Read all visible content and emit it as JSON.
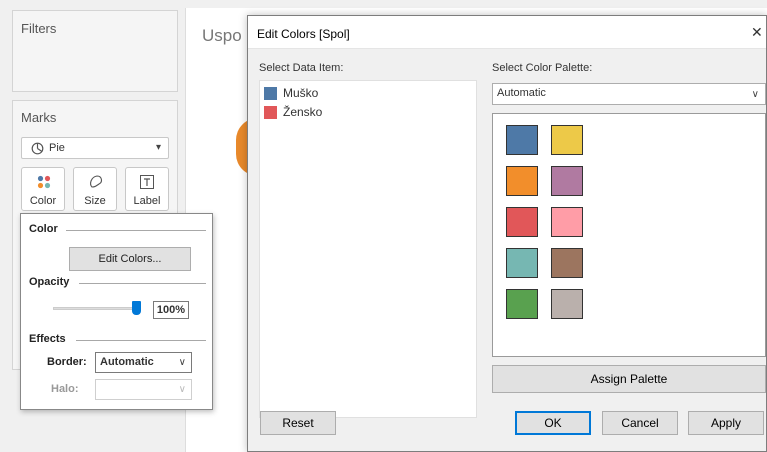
{
  "shelves": {
    "filters_title": "Filters",
    "marks_title": "Marks",
    "mark_type": "Pie",
    "mark_buttons": [
      "Color",
      "Size",
      "Label"
    ]
  },
  "sheet": {
    "title_partial": "Uspo"
  },
  "color_popup": {
    "color_section": "Color",
    "edit_colors_button": "Edit Colors...",
    "opacity_section": "Opacity",
    "opacity_value": "100%",
    "opacity_level": 1.0,
    "effects_section": "Effects",
    "border_label": "Border:",
    "border_value": "Automatic",
    "halo_label": "Halo:",
    "halo_value": ""
  },
  "dialog": {
    "title": "Edit Colors [Spol]",
    "close_symbol": "✕",
    "select_data_item_label": "Select Data Item:",
    "data_items": [
      {
        "label": "Muško",
        "color": "#4e79a7"
      },
      {
        "label": "Žensko",
        "color": "#e15759"
      }
    ],
    "select_palette_label": "Select Color Palette:",
    "palette_name": "Automatic",
    "palette_colors": [
      "#4e79a7",
      "#edc948",
      "#f28e2b",
      "#b07aa1",
      "#e15759",
      "#ff9da7",
      "#76b7b2",
      "#9c755f",
      "#59a14f",
      "#bab0ac"
    ],
    "assign_palette_button": "Assign Palette",
    "reset_button": "Reset",
    "ok_button": "OK",
    "cancel_button": "Cancel",
    "apply_button": "Apply"
  },
  "colors": {
    "accent": "#0078d7",
    "pie_orange": "#e8892b"
  }
}
